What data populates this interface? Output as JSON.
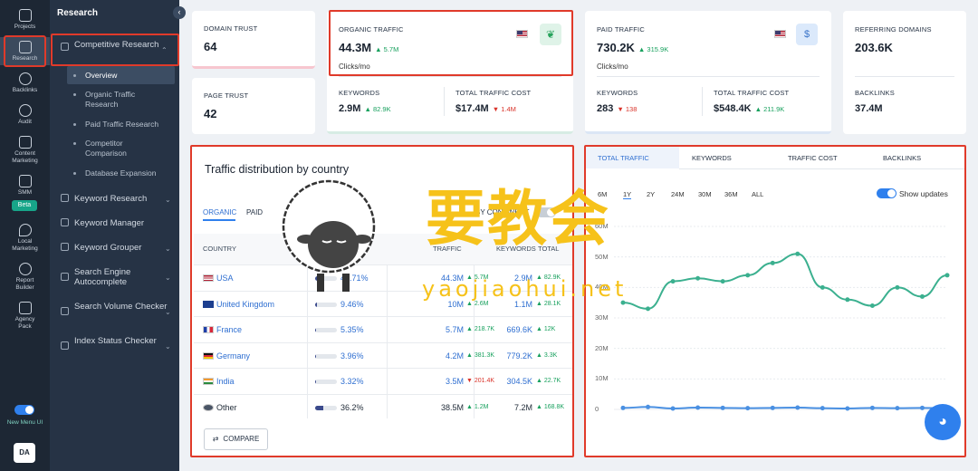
{
  "rail": {
    "items": [
      {
        "label": "Projects",
        "icon": "home-icon"
      },
      {
        "label": "Research",
        "icon": "research-icon"
      },
      {
        "label": "Backlinks",
        "icon": "backlinks-icon"
      },
      {
        "label": "Audit",
        "icon": "audit-icon"
      },
      {
        "label": "Content Marketing",
        "icon": "content-icon"
      },
      {
        "label": "SMM",
        "icon": "smm-icon"
      },
      {
        "label": "Local Marketing",
        "icon": "location-icon"
      },
      {
        "label": "Report Builder",
        "icon": "report-icon"
      },
      {
        "label": "Agency Pack",
        "icon": "agency-icon"
      }
    ],
    "beta": "Beta",
    "new_menu": "New Menu UI",
    "avatar": "DA"
  },
  "sidebar": {
    "title": "Research",
    "collapse": "‹",
    "competitive": "Competitive Research",
    "subs": [
      "Overview",
      "Organic Traffic Research",
      "Paid Traffic Research",
      "Competitor Comparison",
      "Database Expansion"
    ],
    "menu": [
      "Keyword Research",
      "Keyword Manager",
      "Keyword Grouper",
      "Search Engine Autocomplete",
      "Search Volume Checker",
      "Index Status Checker"
    ]
  },
  "cards": {
    "domain_trust": {
      "label": "DOMAIN TRUST",
      "value": "64"
    },
    "page_trust": {
      "label": "PAGE TRUST",
      "value": "42"
    },
    "organic": {
      "label": "ORGANIC TRAFFIC",
      "value": "44.3M",
      "delta": "▲ 5.7M",
      "unit": "Clicks/mo",
      "kw_label": "KEYWORDS",
      "kw_value": "2.9M",
      "kw_delta": "▲ 82.9K",
      "cost_label": "TOTAL TRAFFIC COST",
      "cost_value": "$17.4M",
      "cost_delta": "▼ 1.4M"
    },
    "paid": {
      "label": "PAID TRAFFIC",
      "value": "730.2K",
      "delta": "▲ 315.9K",
      "unit": "Clicks/mo",
      "kw_label": "KEYWORDS",
      "kw_value": "283",
      "kw_delta": "▼ 138",
      "cost_label": "TOTAL TRAFFIC COST",
      "cost_value": "$548.4K",
      "cost_delta": "▲ 211.9K",
      "dollar": "$"
    },
    "referring": {
      "label": "REFERRING DOMAINS",
      "value": "203.6K"
    },
    "backlinks": {
      "label": "BACKLINKS",
      "value": "37.4M"
    }
  },
  "table": {
    "title": "Traffic distribution by country",
    "tabs": [
      "ORGANIC",
      "PAID"
    ],
    "continent": "BY CONTINENT",
    "headers": [
      "COUNTRY",
      "TRAFFIC",
      "KEYWORDS",
      "TOTAL"
    ],
    "rows": [
      {
        "country": "USA",
        "flag": "us",
        "pct": "41.71%",
        "share": 0.42,
        "traffic": "44.3M",
        "tdelta": "▲ 5.7M",
        "tdir": "up",
        "kw": "2.9M",
        "kdelta": "▲ 82.9K",
        "kdir": "up"
      },
      {
        "country": "United Kingdom",
        "flag": "uk",
        "pct": "9.46%",
        "share": 0.09,
        "traffic": "10M",
        "tdelta": "▲ 2.6M",
        "tdir": "up",
        "kw": "1.1M",
        "kdelta": "▲ 28.1K",
        "kdir": "up"
      },
      {
        "country": "France",
        "flag": "fr",
        "pct": "5.35%",
        "share": 0.05,
        "traffic": "5.7M",
        "tdelta": "▲ 218.7K",
        "tdir": "up",
        "kw": "669.6K",
        "kdelta": "▲ 12K",
        "kdir": "up"
      },
      {
        "country": "Germany",
        "flag": "de",
        "pct": "3.96%",
        "share": 0.04,
        "traffic": "4.2M",
        "tdelta": "▲ 381.3K",
        "tdir": "up",
        "kw": "779.2K",
        "kdelta": "▲ 3.3K",
        "kdir": "up"
      },
      {
        "country": "India",
        "flag": "in",
        "pct": "3.32%",
        "share": 0.03,
        "traffic": "3.5M",
        "tdelta": "▼ 201.4K",
        "tdir": "down",
        "kw": "304.5K",
        "kdelta": "▲ 22.7K",
        "kdir": "up"
      },
      {
        "country": "Other",
        "flag": "other",
        "pct": "36.2%",
        "share": 0.36,
        "traffic": "38.5M",
        "tdelta": "▲ 1.2M",
        "tdir": "up",
        "kw": "7.2M",
        "kdelta": "▲ 168.8K",
        "kdir": "up"
      }
    ],
    "compare": "COMPARE"
  },
  "chart_panel": {
    "tabs": [
      "TOTAL TRAFFIC",
      "KEYWORDS",
      "TRAFFIC COST",
      "BACKLINKS"
    ],
    "ranges": [
      "6M",
      "1Y",
      "2Y",
      "24M",
      "30M",
      "36M",
      "ALL"
    ],
    "show_updates": "Show updates"
  },
  "chart_data": {
    "type": "line",
    "yticks": [
      "60M",
      "50M",
      "40M",
      "30M",
      "20M",
      "10M",
      "0"
    ],
    "ylim": [
      0,
      60
    ],
    "series": [
      {
        "color": "#3bb08f",
        "values": [
          35,
          33,
          42,
          43,
          42,
          44,
          48,
          51,
          40,
          36,
          34,
          40,
          37,
          44
        ]
      },
      {
        "color": "#4a90e2",
        "values": [
          0.5,
          0.8,
          0.3,
          0.6,
          0.5,
          0.4,
          0.5,
          0.6,
          0.4,
          0.3,
          0.5,
          0.4,
          0.5,
          0.4
        ]
      }
    ]
  },
  "watermark": {
    "cn": "要教会",
    "url": "yaojiaohui.net"
  }
}
